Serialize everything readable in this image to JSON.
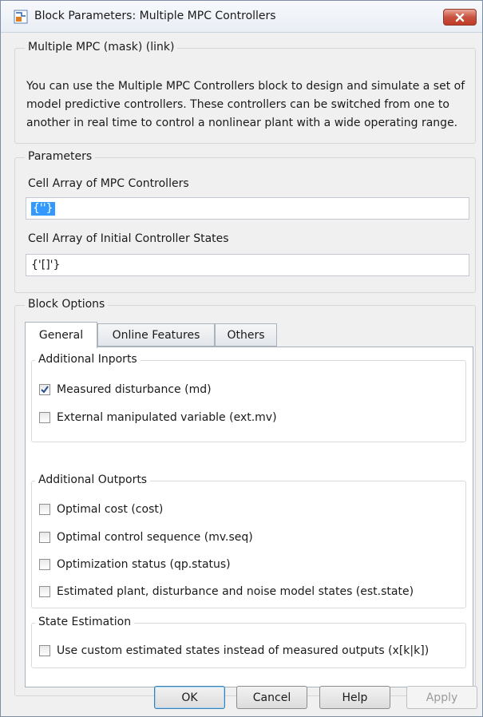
{
  "window": {
    "title": "Block Parameters: Multiple MPC Controllers",
    "close_icon": "close-icon"
  },
  "mask": {
    "legend": "Multiple MPC (mask) (link)",
    "description": "You can use the Multiple MPC Controllers block to design and simulate a set of model predictive controllers. These controllers can be switched from one to another in real time to control a nonlinear plant with a wide operating range."
  },
  "parameters": {
    "legend": "Parameters",
    "controllers_label": "Cell Array of MPC Controllers",
    "controllers_value": "{''}",
    "states_label": "Cell Array of Initial Controller States",
    "states_value": "{'[]'}"
  },
  "block_options": {
    "legend": "Block Options",
    "tabs": [
      {
        "label": "General",
        "active": true
      },
      {
        "label": "Online Features",
        "active": false
      },
      {
        "label": "Others",
        "active": false
      }
    ],
    "inports": {
      "legend": "Additional Inports",
      "items": [
        {
          "label": "Measured disturbance (md)",
          "checked": true
        },
        {
          "label": "External manipulated variable (ext.mv)",
          "checked": false
        }
      ]
    },
    "outports": {
      "legend": "Additional Outports",
      "items": [
        {
          "label": "Optimal cost (cost)",
          "checked": false
        },
        {
          "label": "Optimal control sequence (mv.seq)",
          "checked": false
        },
        {
          "label": "Optimization status (qp.status)",
          "checked": false
        },
        {
          "label": "Estimated plant, disturbance and noise model states (est.state)",
          "checked": false
        }
      ]
    },
    "state_estimation": {
      "legend": "State Estimation",
      "items": [
        {
          "label": "Use custom estimated states instead of measured outputs (x[k|k])",
          "checked": false
        }
      ]
    }
  },
  "buttons": {
    "ok": "OK",
    "cancel": "Cancel",
    "help": "Help",
    "apply": "Apply"
  },
  "colors": {
    "selection": "#3399ff",
    "close_button": "#c9523f",
    "checkmark": "#2b4c8c"
  }
}
